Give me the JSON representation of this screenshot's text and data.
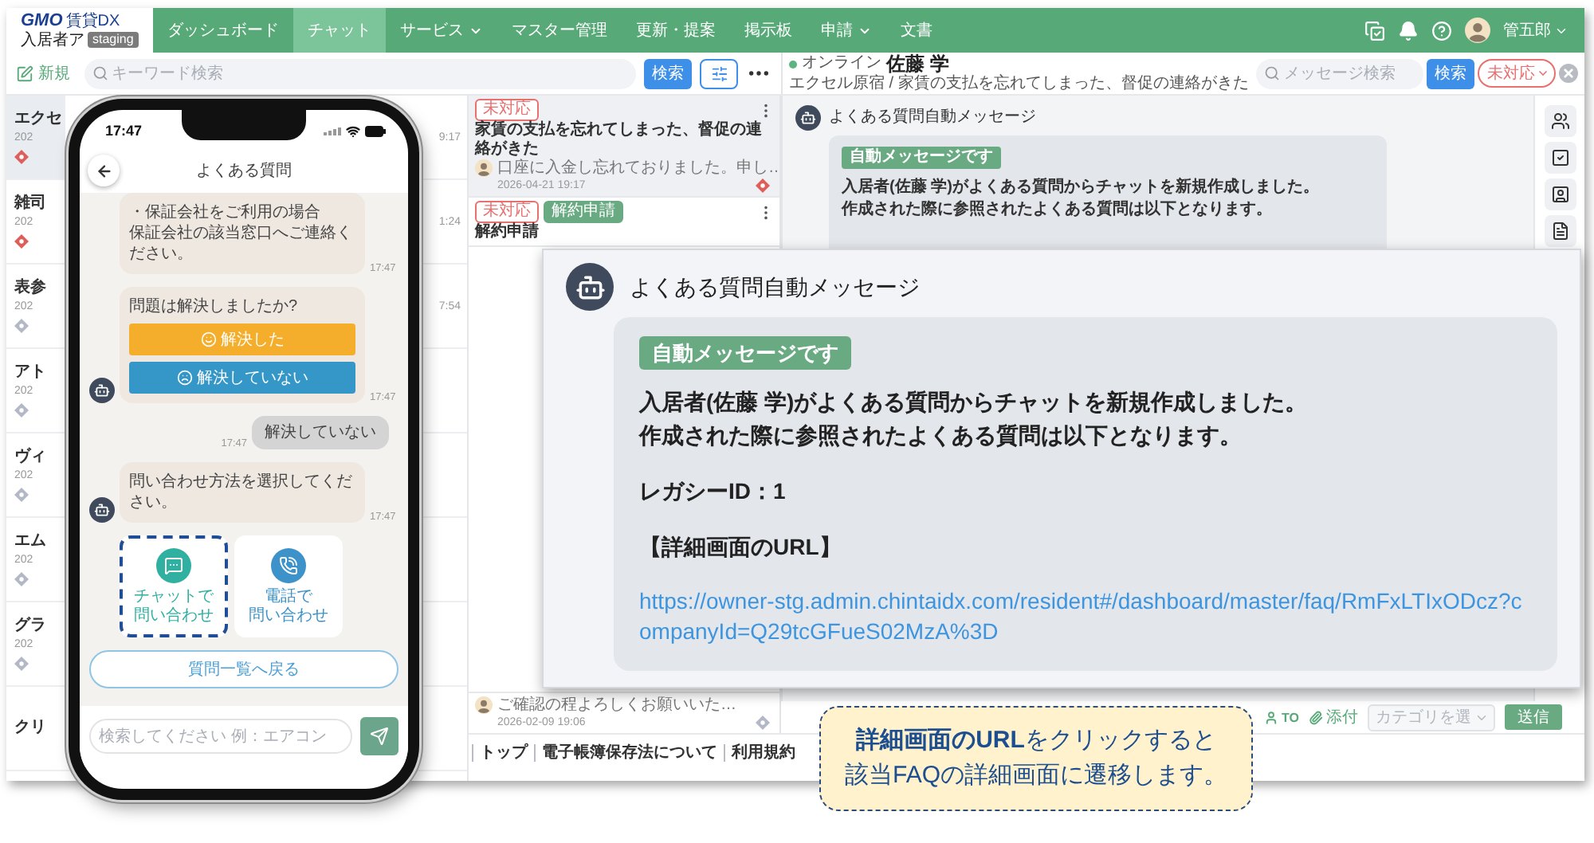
{
  "topbar": {
    "logo": {
      "brand": "GMO",
      "product": "賃貸DX",
      "subtitle": "入居者ア",
      "badge": "staging"
    },
    "nav": [
      {
        "label": "ダッシュボード",
        "selected": false,
        "dropdown": false
      },
      {
        "label": "チャット",
        "selected": true,
        "dropdown": false
      },
      {
        "label": "サービス",
        "selected": false,
        "dropdown": true
      },
      {
        "label": "マスター管理",
        "selected": false,
        "dropdown": false
      },
      {
        "label": "更新・提案",
        "selected": false,
        "dropdown": false
      },
      {
        "label": "掲示板",
        "selected": false,
        "dropdown": false
      },
      {
        "label": "申請",
        "selected": false,
        "dropdown": true
      },
      {
        "label": "文書",
        "selected": false,
        "dropdown": false
      }
    ],
    "user": "管五郎"
  },
  "toolbar": {
    "new": "新規",
    "search_placeholder": "キーワード検索",
    "search_button": "検索"
  },
  "residents": [
    {
      "name": "エクセ",
      "date": "202",
      "time": "9:17",
      "color": "#dd5f5a",
      "selected": true
    },
    {
      "name": "雑司",
      "date": "202",
      "time": "1:24",
      "color": "#dd5f5a",
      "selected": false
    },
    {
      "name": "表参",
      "date": "202",
      "time": "7:54",
      "color": "#b3b8c6",
      "selected": false
    },
    {
      "name": "アト",
      "date": "202",
      "color": "#b3b8c6",
      "selected": false
    },
    {
      "name": "ヴィ",
      "date": "202",
      "color": "#b3b8c6",
      "selected": false
    },
    {
      "name": "エム",
      "date": "202",
      "color": "#b3b8c6",
      "selected": false
    },
    {
      "name": "グラ",
      "date": "202",
      "color": "#b3b8c6",
      "selected": false
    },
    {
      "name": "クリ",
      "selected": false
    }
  ],
  "tickets": [
    {
      "tags": [
        {
          "label": "未対応",
          "kind": "status"
        }
      ],
      "title": "家賃の支払を忘れてしまった、督促の連絡がきた",
      "preview": "口座に入金し忘れておりました。申し…",
      "date": "2026-04-21 19:17",
      "color": "#dd5f5a",
      "selected": true
    },
    {
      "tags": [
        {
          "label": "未対応",
          "kind": "status"
        },
        {
          "label": "解約申請",
          "kind": "category"
        }
      ],
      "title": "解約申請",
      "selected": false
    },
    {
      "preview": "ご確認の程よろしくお願いいた…",
      "date": "2026-02-09 19:06",
      "color": "#b3b8c6",
      "selected": false
    }
  ],
  "chat": {
    "status": "オンライン",
    "online": true,
    "name": "佐藤 学",
    "subtitle": "エクセル原宿 / 家賃の支払を忘れてしまった、督促の連絡がきた",
    "search_placeholder": "メッセージ検索",
    "search_button": "検索",
    "filter": "未対応",
    "message": {
      "sender": "よくある質問自動メッセージ",
      "tag": "自動メッセージです",
      "lines": [
        "入居者(佐藤 学)がよくある質問からチャットを新規作成しました。",
        "作成された際に参照されたよくある質問は以下となります。"
      ]
    },
    "composer": {
      "to": "TO",
      "attach": "添付",
      "category": "カテゴリを選",
      "send": "送信"
    }
  },
  "footer": [
    "トップ",
    "電子帳簿保存法について",
    "利用規約"
  ],
  "phone": {
    "time": "17:47",
    "title": "よくある質問",
    "messages": [
      {
        "kind": "bot",
        "lines": [
          "・保証会社をご利用の場合",
          "保証会社の該当窓口へご連絡ください。"
        ],
        "time": "17:47",
        "avatar": false
      },
      {
        "kind": "bot",
        "lines": [
          "問題は解決しましたか?"
        ],
        "buttons": [
          {
            "label": "解決した",
            "kind": "positive",
            "color": "#f4ae2b"
          },
          {
            "label": "解決していない",
            "kind": "negative",
            "color": "#3596c8"
          }
        ],
        "time": "17:47",
        "avatar": true
      },
      {
        "kind": "user",
        "text": "解決していない",
        "time": "17:47"
      },
      {
        "kind": "bot",
        "lines": [
          "問い合わせ方法を選択してください。"
        ],
        "time": "17:47",
        "avatar": true
      }
    ],
    "contact_options": [
      {
        "label_lines": [
          "チャットで",
          "問い合わせ"
        ],
        "kind": "chat",
        "color": "#2fb0a0",
        "highlighted": true
      },
      {
        "label_lines": [
          "電話で",
          "問い合わせ"
        ],
        "kind": "phone",
        "color": "#3c92c9",
        "highlighted": false
      }
    ],
    "back_button": "質問一覧へ戻る",
    "input_placeholder": "検索してください 例：エアコン"
  },
  "zoom_callout": {
    "sender": "よくある質問自動メッセージ",
    "tag": "自動メッセージです",
    "blocks": [
      [
        "入居者(佐藤 学)がよくある質問からチャットを新規作成しました。",
        "作成された際に参照されたよくある質問は以下となります。"
      ],
      [
        "レガシーID：1"
      ],
      [
        "【詳細画面のURL】"
      ]
    ],
    "link": "https://owner-stg.admin.chintaidx.com/resident#/dashboard/master/faq/RmFxLTIxODcz?companyId=Q29tcGFueS02MzA%3D"
  },
  "note": {
    "lines": [
      "**詳細画面のURL**をクリックすると",
      "該当FAQの詳細画面に遷移します。"
    ]
  }
}
